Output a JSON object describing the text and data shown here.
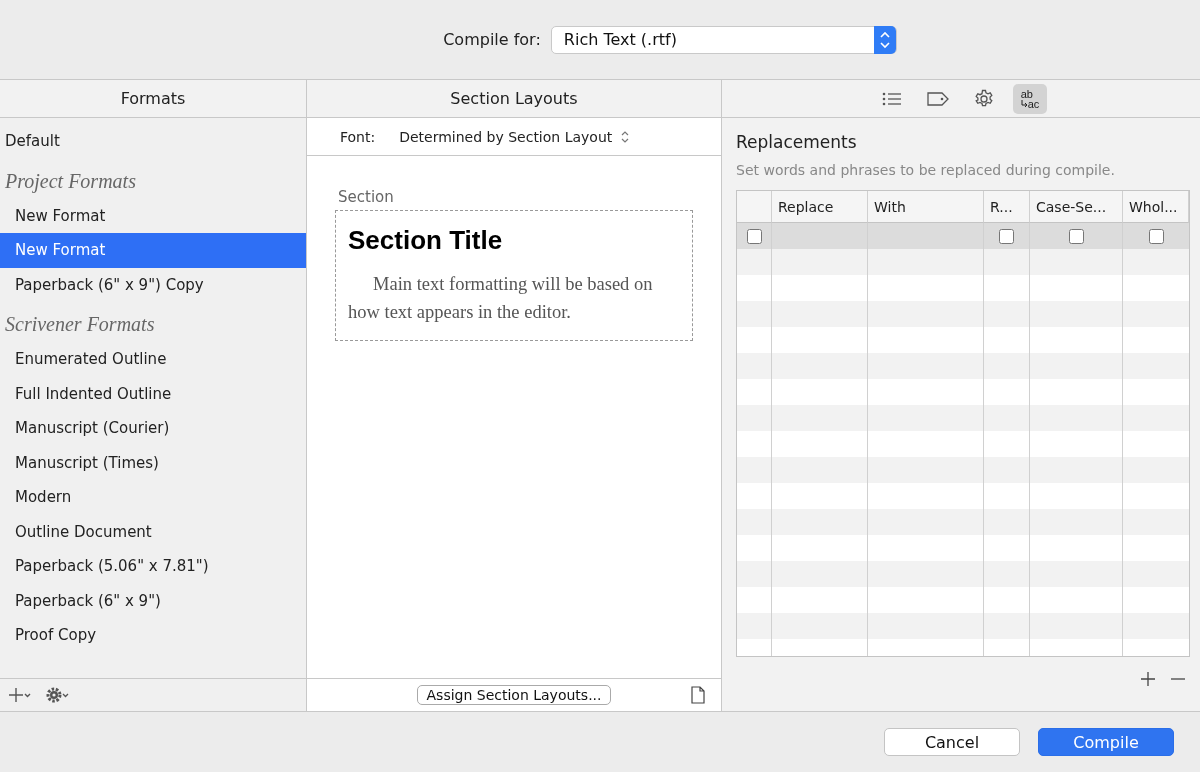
{
  "compile_for": {
    "label": "Compile for:",
    "value": "Rich Text (.rtf)"
  },
  "formats": {
    "title": "Formats",
    "groups": [
      {
        "items": [
          {
            "label": "Default",
            "selected": false
          }
        ]
      },
      {
        "heading": "Project Formats",
        "items": [
          {
            "label": "New Format",
            "selected": false
          },
          {
            "label": "New Format",
            "selected": true
          },
          {
            "label": "Paperback (6\" x 9\") Copy",
            "selected": false
          }
        ]
      },
      {
        "heading": "Scrivener Formats",
        "items": [
          {
            "label": "Enumerated Outline",
            "selected": false
          },
          {
            "label": "Full Indented Outline",
            "selected": false
          },
          {
            "label": "Manuscript (Courier)",
            "selected": false
          },
          {
            "label": "Manuscript (Times)",
            "selected": false
          },
          {
            "label": "Modern",
            "selected": false
          },
          {
            "label": "Outline Document",
            "selected": false
          },
          {
            "label": "Paperback (5.06\" x 7.81\")",
            "selected": false
          },
          {
            "label": "Paperback (6\" x 9\")",
            "selected": false
          },
          {
            "label": "Proof Copy",
            "selected": false
          }
        ]
      }
    ]
  },
  "section_layouts": {
    "title": "Section Layouts",
    "font_label": "Font:",
    "font_value": "Determined by Section Layout",
    "preview_label": "Section",
    "preview_title": "Section Title",
    "preview_body": "Main text formatting will be based on how text appears in the editor.",
    "assign_button": "Assign Section Layouts..."
  },
  "inspector": {
    "tabs": [
      {
        "kind": "list",
        "selected": false
      },
      {
        "kind": "tag",
        "selected": false
      },
      {
        "kind": "gear",
        "selected": false
      },
      {
        "kind": "replace",
        "selected": true,
        "top": "ab",
        "bottom": "ac"
      }
    ],
    "title": "Replacements",
    "description": "Set words and phrases to be replaced during compile.",
    "columns": [
      "Replace",
      "With",
      "R...",
      "Case-Se...",
      "Whol..."
    ],
    "rows": [
      {
        "selected": true,
        "enabled": false,
        "r": false,
        "case": false,
        "whole": false
      }
    ]
  },
  "buttons": {
    "cancel": "Cancel",
    "compile": "Compile"
  }
}
